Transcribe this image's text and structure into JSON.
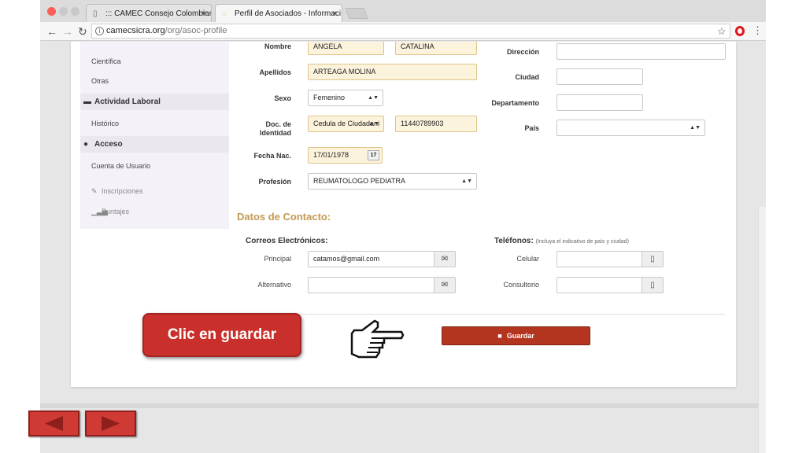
{
  "browser": {
    "tabs": [
      {
        "label": "::: CAMEC Consejo Colombian"
      },
      {
        "label": "Perfil de Asociados - Informaci"
      }
    ],
    "tab_close": "×",
    "url_domain": "camecsicra.org",
    "url_path": "/org/asoc-profile"
  },
  "sidebar": {
    "items_top": [
      "Científica",
      "Otras"
    ],
    "section_laboral": "Actividad Laboral",
    "item_historico": "Histórico",
    "section_acceso": "Acceso",
    "item_cuenta": "Cuenta de Usuario",
    "item_inscripciones": "Inscripciones",
    "item_puntajes": "Puntajes"
  },
  "form": {
    "nombre_label": "Nombre",
    "nombre_1": "ANGELA",
    "nombre_2": "CATALINA",
    "apellidos_label": "Apellidos",
    "apellidos": "ARTEAGA MOLINA",
    "sexo_label": "Sexo",
    "sexo": "Femenino",
    "doc_label_1": "Doc. de",
    "doc_label_2": "Identidad",
    "doc_tipo": "Cedula de Ciudadani",
    "doc_numero": "11440789903",
    "fecha_label": "Fecha Nac.",
    "fecha": "17/01/1978",
    "cal_day": "17",
    "profesion_label": "Profesión",
    "profesion": "REUMATOLOGO PEDIATRA",
    "direccion_label": "Dirección",
    "ciudad_label": "Ciudad",
    "departamento_label": "Departamento",
    "pais_label": "País"
  },
  "contacto": {
    "title": "Datos de Contacto:",
    "correos_head": "Correos Electrónicos:",
    "telefonos_head": "Teléfonos:",
    "telefonos_note": "(Incluya el indicativo de país y ciudad)",
    "principal_label": "Principal",
    "principal_email": "catamos@gmail.com",
    "alternativo_label": "Alternativo",
    "celular_label": "Celular",
    "consultorio_label": "Consultorio"
  },
  "actions": {
    "save_label": "Guardar"
  },
  "tutorial": {
    "callout": "Clic en guardar"
  },
  "colors": {
    "save_button": "#b33520",
    "section_title": "#c59a53",
    "highlight_field": "#fcf3dd",
    "callout": "#c9302c"
  }
}
